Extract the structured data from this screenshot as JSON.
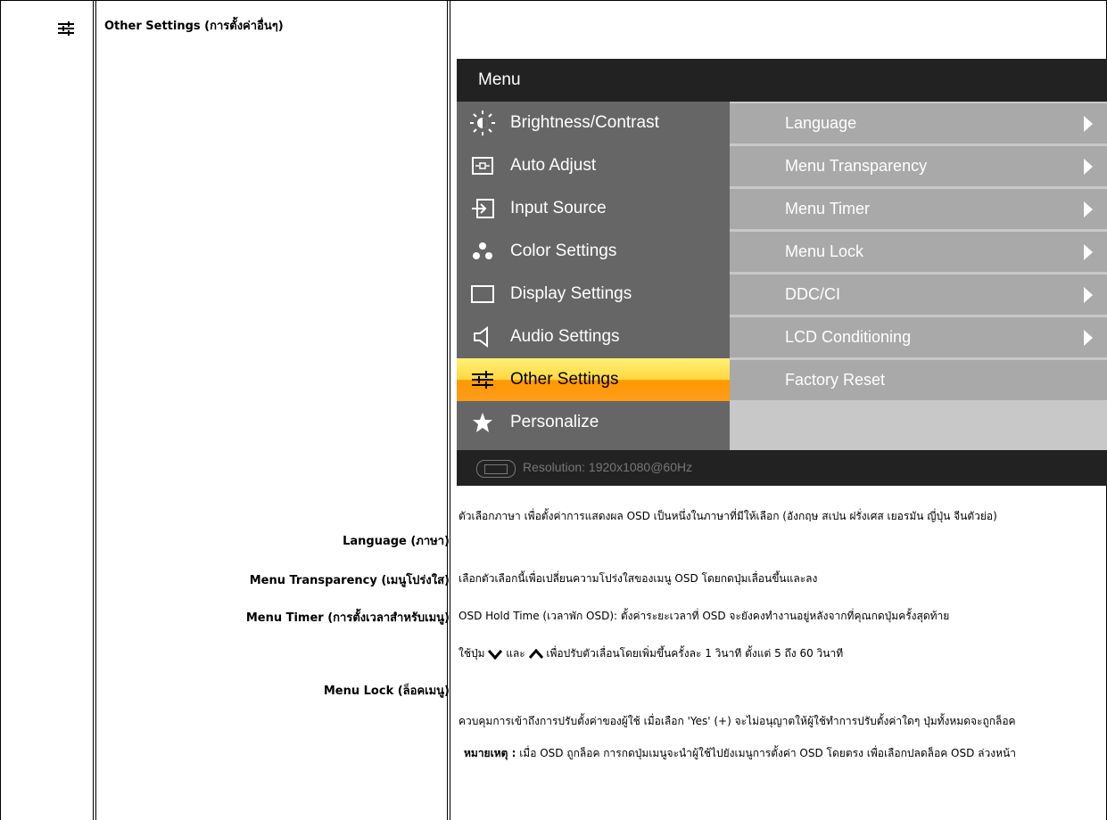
{
  "section": {
    "icon": "sliders-icon",
    "title": "Other Settings (การตั้งค่าอื่นๆ)"
  },
  "osd": {
    "title": "Menu",
    "items": [
      {
        "label": "Brightness/Contrast",
        "icon": "sun-icon"
      },
      {
        "label": "Auto Adjust",
        "icon": "auto-adjust-icon"
      },
      {
        "label": "Input Source",
        "icon": "input-source-icon"
      },
      {
        "label": "Color Settings",
        "icon": "color-dots-icon"
      },
      {
        "label": "Display Settings",
        "icon": "display-rect-icon"
      },
      {
        "label": "Audio Settings",
        "icon": "speaker-icon"
      },
      {
        "label": "Other Settings",
        "icon": "sliders-icon",
        "selected": true
      },
      {
        "label": "Personalize",
        "icon": "star-icon"
      }
    ],
    "submenu": [
      {
        "label": "Language",
        "arrow": true
      },
      {
        "label": "Menu Transparency",
        "arrow": true
      },
      {
        "label": "Menu Timer",
        "arrow": true
      },
      {
        "label": "Menu Lock",
        "arrow": true
      },
      {
        "label": "DDC/CI",
        "arrow": true
      },
      {
        "label": "LCD Conditioning",
        "arrow": true
      },
      {
        "label": "Factory Reset",
        "arrow": false
      }
    ],
    "resolution": "Resolution: 1920x1080@60Hz",
    "colors": {
      "selected_top": "#fff176",
      "selected_bottom": "#ff9900",
      "panel": "#666666",
      "submenu": "#a9a9a9"
    }
  },
  "rows": {
    "language": {
      "label": "Language (ภาษา)",
      "desc": "ตัวเลือกภาษา เพื่อตั้งค่าการแสดงผล OSD เป็นหนึ่งในภาษาที่มีให้เลือก (อังกฤษ สเปน ฝรั่งเศส เยอรมัน ญี่ปุ่น จีนตัวย่อ)"
    },
    "transparency": {
      "label": "Menu Transparency (เมนูโปร่งใส)",
      "desc": "เลือกตัวเลือกนี้เพื่อเปลี่ยนความโปร่งใสของเมนู OSD โดยกดปุ่มเลื่อนขึ้นและลง"
    },
    "timer": {
      "label": "Menu Timer (การตั้งเวลาสำหรับเมนู)",
      "desc1": "OSD Hold Time (เวลาพัก OSD): ตั้งค่าระยะเวลาที่ OSD จะยังคงทำงานอยู่หลังจากที่คุณกดปุ่มครั้งสุดท้าย",
      "desc2_pre": "ใช้ปุ่ม",
      "desc2_mid": "และ",
      "desc2_post": "เพื่อปรับตัวเลื่อนโดยเพิ่มขึ้นครั้งละ 1 วินาที ตั้งแต่ 5 ถึง 60 วินาที"
    },
    "lock": {
      "label": "Menu Lock (ล็อคเมนู)",
      "desc": "ควบคุมการเข้าถึงการปรับตั้งค่าของผู้ใช้ เมื่อเลือก 'Yes' (+) จะไม่อนุญาตให้ผู้ใช้ทำการปรับตั้งค่าใดๆ ปุ่มทั้งหมดจะถูกล็อค",
      "note_label": "หมายเหตุ :",
      "note": "เมื่อ OSD ถูกล็อค การกดปุ่มเมนูจะนำผู้ใช้ไปยังเมนูการตั้งค่า OSD โดยตรง เพื่อเลือกปลดล็อค OSD ล่วงหน้า"
    }
  }
}
